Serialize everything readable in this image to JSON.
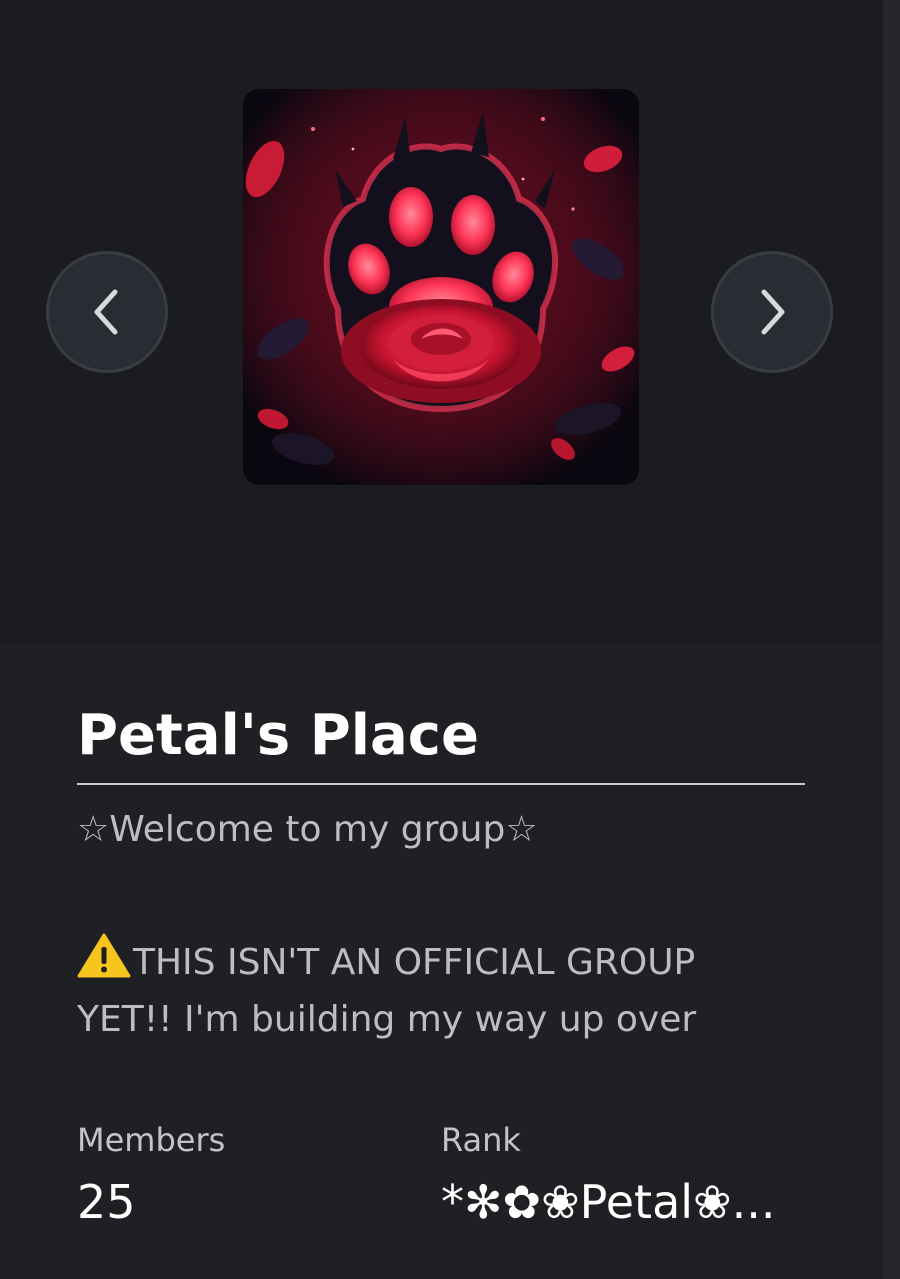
{
  "hero": {
    "thumbnail_icon": "paw-rose-emblem-icon",
    "prev_icon": "chevron-left-icon",
    "next_icon": "chevron-right-icon"
  },
  "group": {
    "name": "Petal's Place",
    "description_lines": [
      "☆Welcome to my group☆",
      "THIS ISN'T AN OFFICIAL GROUP",
      "YET!! I'm building my way up over"
    ],
    "warning_icon": "warning-icon"
  },
  "stats": {
    "members_label": "Members",
    "members_value": "25",
    "rank_label": "Rank",
    "rank_value": "*✻✿❀Petal❀..."
  },
  "colors": {
    "page_bg": "#1f2024",
    "hero_bg": "#1b1c20",
    "text_primary": "#ffffff",
    "text_secondary": "#bcbec4",
    "accent_red": "#e0304a"
  }
}
